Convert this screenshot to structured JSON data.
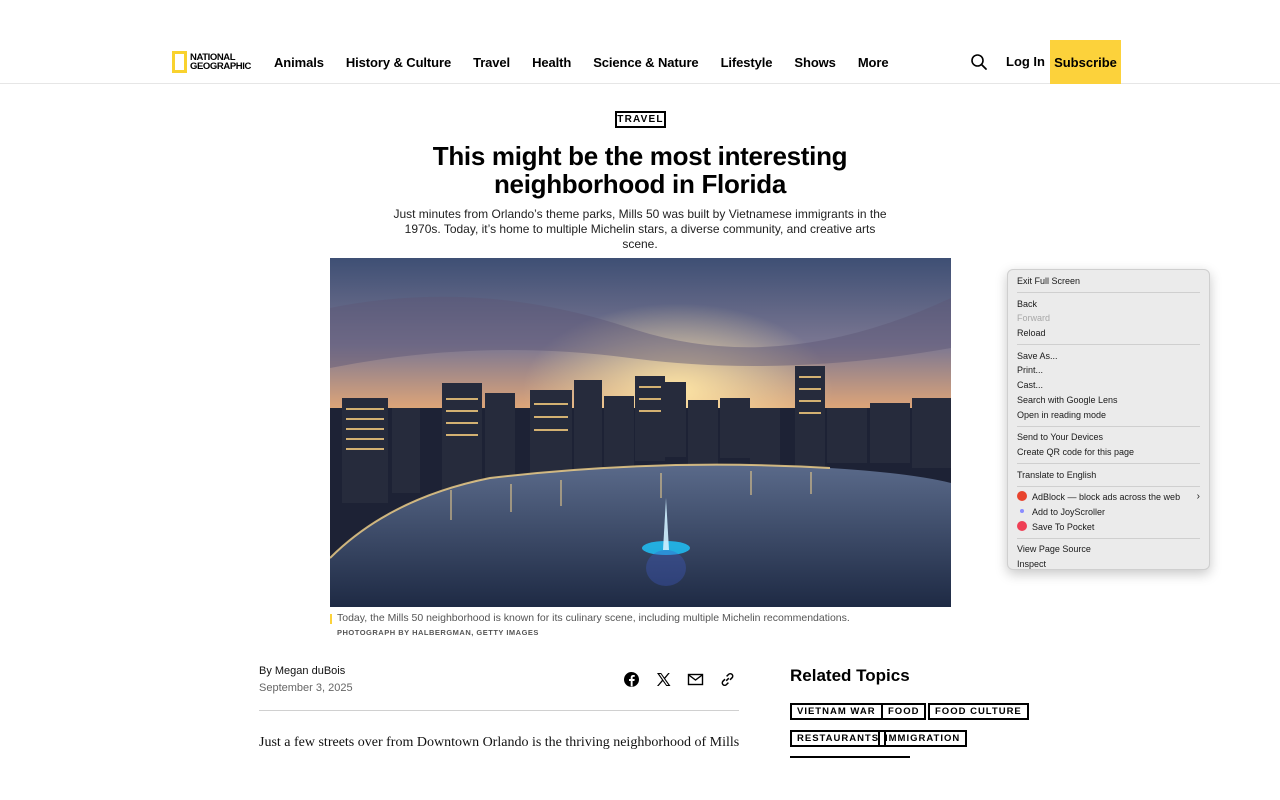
{
  "header": {
    "logo_line1": "NATIONAL",
    "logo_line2": "GEOGRAPHIC",
    "nav": [
      "Animals",
      "History & Culture",
      "Travel",
      "Health",
      "Science & Nature",
      "Lifestyle",
      "Shows",
      "More"
    ],
    "login": "Log In",
    "subscribe": "Subscribe",
    "accent_color": "#fcd23b"
  },
  "article": {
    "kicker": "TRAVEL",
    "headline_line1": "This might be the most interesting",
    "headline_line2": "neighborhood in Florida",
    "dek_line1": "Just minutes from Orlando’s theme parks, Mills 50 was built by Vietnamese immigrants in the",
    "dek_line2": "1970s. Today, it’s home to multiple Michelin stars, a diverse community, and creative arts scene.",
    "caption": "Today, the Mills 50 neighborhood is known for its culinary scene, including multiple Michelin recommendations.",
    "credit": "PHOTOGRAPH BY HALBERGMAN, GETTY IMAGES",
    "byline": "By Megan duBois",
    "date": "September 3, 2025",
    "share_icons": [
      "facebook-icon",
      "x-icon",
      "mail-icon",
      "link-icon"
    ],
    "body_start": "Just a few streets over from Downtown Orlando is the thriving neighborhood of Mills"
  },
  "related": {
    "title": "Related Topics",
    "tags": [
      "VIETNAM WAR",
      "FOOD",
      "FOOD CULTURE",
      "RESTAURANTS",
      "IMMIGRATION"
    ]
  },
  "context_menu": {
    "groups": [
      [
        {
          "label": "Exit Full Screen"
        }
      ],
      [
        {
          "label": "Back"
        },
        {
          "label": "Forward",
          "disabled": true
        },
        {
          "label": "Reload"
        }
      ],
      [
        {
          "label": "Save As..."
        },
        {
          "label": "Print..."
        },
        {
          "label": "Cast..."
        },
        {
          "label": "Search with Google Lens"
        },
        {
          "label": "Open in reading mode"
        }
      ],
      [
        {
          "label": "Send to Your Devices"
        },
        {
          "label": "Create QR code for this page"
        }
      ],
      [
        {
          "label": "Translate to English"
        }
      ],
      [
        {
          "label": "AdBlock — block ads across the web",
          "icon": "adblock-icon",
          "submenu": true
        },
        {
          "label": "Add to JoyScroller",
          "icon": "joyscroller-icon"
        },
        {
          "label": "Save To Pocket",
          "icon": "pocket-icon"
        }
      ],
      [
        {
          "label": "View Page Source"
        },
        {
          "label": "Inspect"
        }
      ]
    ]
  }
}
